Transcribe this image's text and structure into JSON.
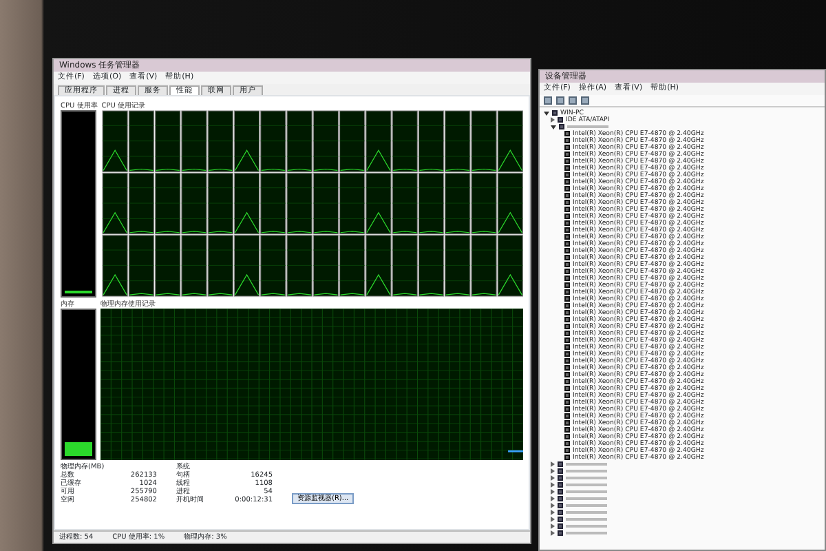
{
  "task_manager": {
    "title": "Windows 任务管理器",
    "menu": [
      "文件(F)",
      "选项(O)",
      "查看(V)",
      "帮助(H)"
    ],
    "tabs": [
      {
        "label": "应用程序",
        "selected": false
      },
      {
        "label": "进程",
        "selected": false
      },
      {
        "label": "服务",
        "selected": false
      },
      {
        "label": "性能",
        "selected": true
      },
      {
        "label": "联网",
        "selected": false
      },
      {
        "label": "用户",
        "selected": false
      }
    ],
    "cpu_usage": {
      "label": "CPU 使用率",
      "level": 0.02
    },
    "cpu_history": {
      "label": "CPU 使用记录"
    },
    "memory": {
      "label": "内存",
      "level": 0.1
    },
    "memory_history": {
      "label": "物理内存使用记录"
    },
    "stats": [
      {
        "title": "物理内存(MB)",
        "rows": [
          [
            "总数",
            "262133"
          ],
          [
            "已缓存",
            "1024"
          ],
          [
            "可用",
            "255790"
          ],
          [
            "空闲",
            "254802"
          ]
        ]
      },
      {
        "title": "系统",
        "rows": [
          [
            "句柄",
            "16245"
          ],
          [
            "线程",
            "1108"
          ],
          [
            "进程",
            "54"
          ],
          [
            "开机时间",
            "0:00:12:31"
          ]
        ]
      }
    ],
    "resource_button": "资源监视器(R)...",
    "status_bar": [
      "进程数: 54",
      "CPU 使用率: 1%",
      "物理内存: 3%"
    ]
  },
  "device_manager": {
    "title": "设备管理器",
    "menu": [
      "文件(F)",
      "操作(A)",
      "查看(V)",
      "帮助(H)"
    ],
    "tree": [
      {
        "label": "WIN-PC",
        "expanded": true,
        "children": [
          {
            "label": "IDE ATA/ATAPI",
            "expanded": false
          },
          {
            "expanded": true,
            "children": [
              {
                "label": "Intel(R) Xeon(R) CPU E7-4870 @ 2.40GHz"
              },
              {
                "label": "Intel(R) Xeon(R) CPU E7-4870 @ 2.40GHz"
              },
              {
                "label": "Intel(R) Xeon(R) CPU E7-4870 @ 2.40GHz"
              },
              {
                "label": "Intel(R) Xeon(R) CPU E7-4870 @ 2.40GHz"
              },
              {
                "label": "Intel(R) Xeon(R) CPU E7-4870 @ 2.40GHz"
              },
              {
                "label": "Intel(R) Xeon(R) CPU E7-4870 @ 2.40GHz"
              },
              {
                "label": "Intel(R) Xeon(R) CPU E7-4870 @ 2.40GHz"
              },
              {
                "label": "Intel(R) Xeon(R) CPU E7-4870 @ 2.40GHz"
              },
              {
                "label": "Intel(R) Xeon(R) CPU E7-4870 @ 2.40GHz"
              },
              {
                "label": "Intel(R) Xeon(R) CPU E7-4870 @ 2.40GHz"
              },
              {
                "label": "Intel(R) Xeon(R) CPU E7-4870 @ 2.40GHz"
              },
              {
                "label": "Intel(R) Xeon(R) CPU E7-4870 @ 2.40GHz"
              },
              {
                "label": "Intel(R) Xeon(R) CPU E7-4870 @ 2.40GHz"
              },
              {
                "label": "Intel(R) Xeon(R) CPU E7-4870 @ 2.40GHz"
              },
              {
                "label": "Intel(R) Xeon(R) CPU E7-4870 @ 2.40GHz"
              },
              {
                "label": "Intel(R) Xeon(R) CPU E7-4870 @ 2.40GHz"
              },
              {
                "label": "Intel(R) Xeon(R) CPU E7-4870 @ 2.40GHz"
              },
              {
                "label": "Intel(R) Xeon(R) CPU E7-4870 @ 2.40GHz"
              },
              {
                "label": "Intel(R) Xeon(R) CPU E7-4870 @ 2.40GHz"
              },
              {
                "label": "Intel(R) Xeon(R) CPU E7-4870 @ 2.40GHz"
              },
              {
                "label": "Intel(R) Xeon(R) CPU E7-4870 @ 2.40GHz"
              },
              {
                "label": "Intel(R) Xeon(R) CPU E7-4870 @ 2.40GHz"
              },
              {
                "label": "Intel(R) Xeon(R) CPU E7-4870 @ 2.40GHz"
              },
              {
                "label": "Intel(R) Xeon(R) CPU E7-4870 @ 2.40GHz"
              },
              {
                "label": "Intel(R) Xeon(R) CPU E7-4870 @ 2.40GHz"
              },
              {
                "label": "Intel(R) Xeon(R) CPU E7-4870 @ 2.40GHz"
              },
              {
                "label": "Intel(R) Xeon(R) CPU E7-4870 @ 2.40GHz"
              },
              {
                "label": "Intel(R) Xeon(R) CPU E7-4870 @ 2.40GHz"
              },
              {
                "label": "Intel(R) Xeon(R) CPU E7-4870 @ 2.40GHz"
              },
              {
                "label": "Intel(R) Xeon(R) CPU E7-4870 @ 2.40GHz"
              },
              {
                "label": "Intel(R) Xeon(R) CPU E7-4870 @ 2.40GHz"
              },
              {
                "label": "Intel(R) Xeon(R) CPU E7-4870 @ 2.40GHz"
              },
              {
                "label": "Intel(R) Xeon(R) CPU E7-4870 @ 2.40GHz"
              },
              {
                "label": "Intel(R) Xeon(R) CPU E7-4870 @ 2.40GHz"
              },
              {
                "label": "Intel(R) Xeon(R) CPU E7-4870 @ 2.40GHz"
              },
              {
                "label": "Intel(R) Xeon(R) CPU E7-4870 @ 2.40GHz"
              },
              {
                "label": "Intel(R) Xeon(R) CPU E7-4870 @ 2.40GHz"
              },
              {
                "label": "Intel(R) Xeon(R) CPU E7-4870 @ 2.40GHz"
              },
              {
                "label": "Intel(R) Xeon(R) CPU E7-4870 @ 2.40GHz"
              },
              {
                "label": "Intel(R) Xeon(R) CPU E7-4870 @ 2.40GHz"
              },
              {
                "label": "Intel(R) Xeon(R) CPU E7-4870 @ 2.40GHz"
              },
              {
                "label": "Intel(R) Xeon(R) CPU E7-4870 @ 2.40GHz"
              },
              {
                "label": "Intel(R) Xeon(R) CPU E7-4870 @ 2.40GHz"
              },
              {
                "label": "Intel(R) Xeon(R) CPU E7-4870 @ 2.40GHz"
              },
              {
                "label": "Intel(R) Xeon(R) CPU E7-4870 @ 2.40GHz"
              },
              {
                "label": "Intel(R) Xeon(R) CPU E7-4870 @ 2.40GHz"
              },
              {
                "label": "Intel(R) Xeon(R) CPU E7-4870 @ 2.40GHz"
              },
              {
                "label": "Intel(R) Xeon(R) CPU E7-4870 @ 2.40GHz"
              }
            ]
          },
          {
            "expanded": false
          },
          {
            "expanded": false
          },
          {
            "expanded": false
          },
          {
            "expanded": false
          },
          {
            "expanded": false
          },
          {
            "expanded": false
          },
          {
            "expanded": false
          },
          {
            "expanded": false
          },
          {
            "expanded": false
          },
          {
            "expanded": false
          },
          {
            "expanded": false
          }
        ]
      }
    ]
  }
}
